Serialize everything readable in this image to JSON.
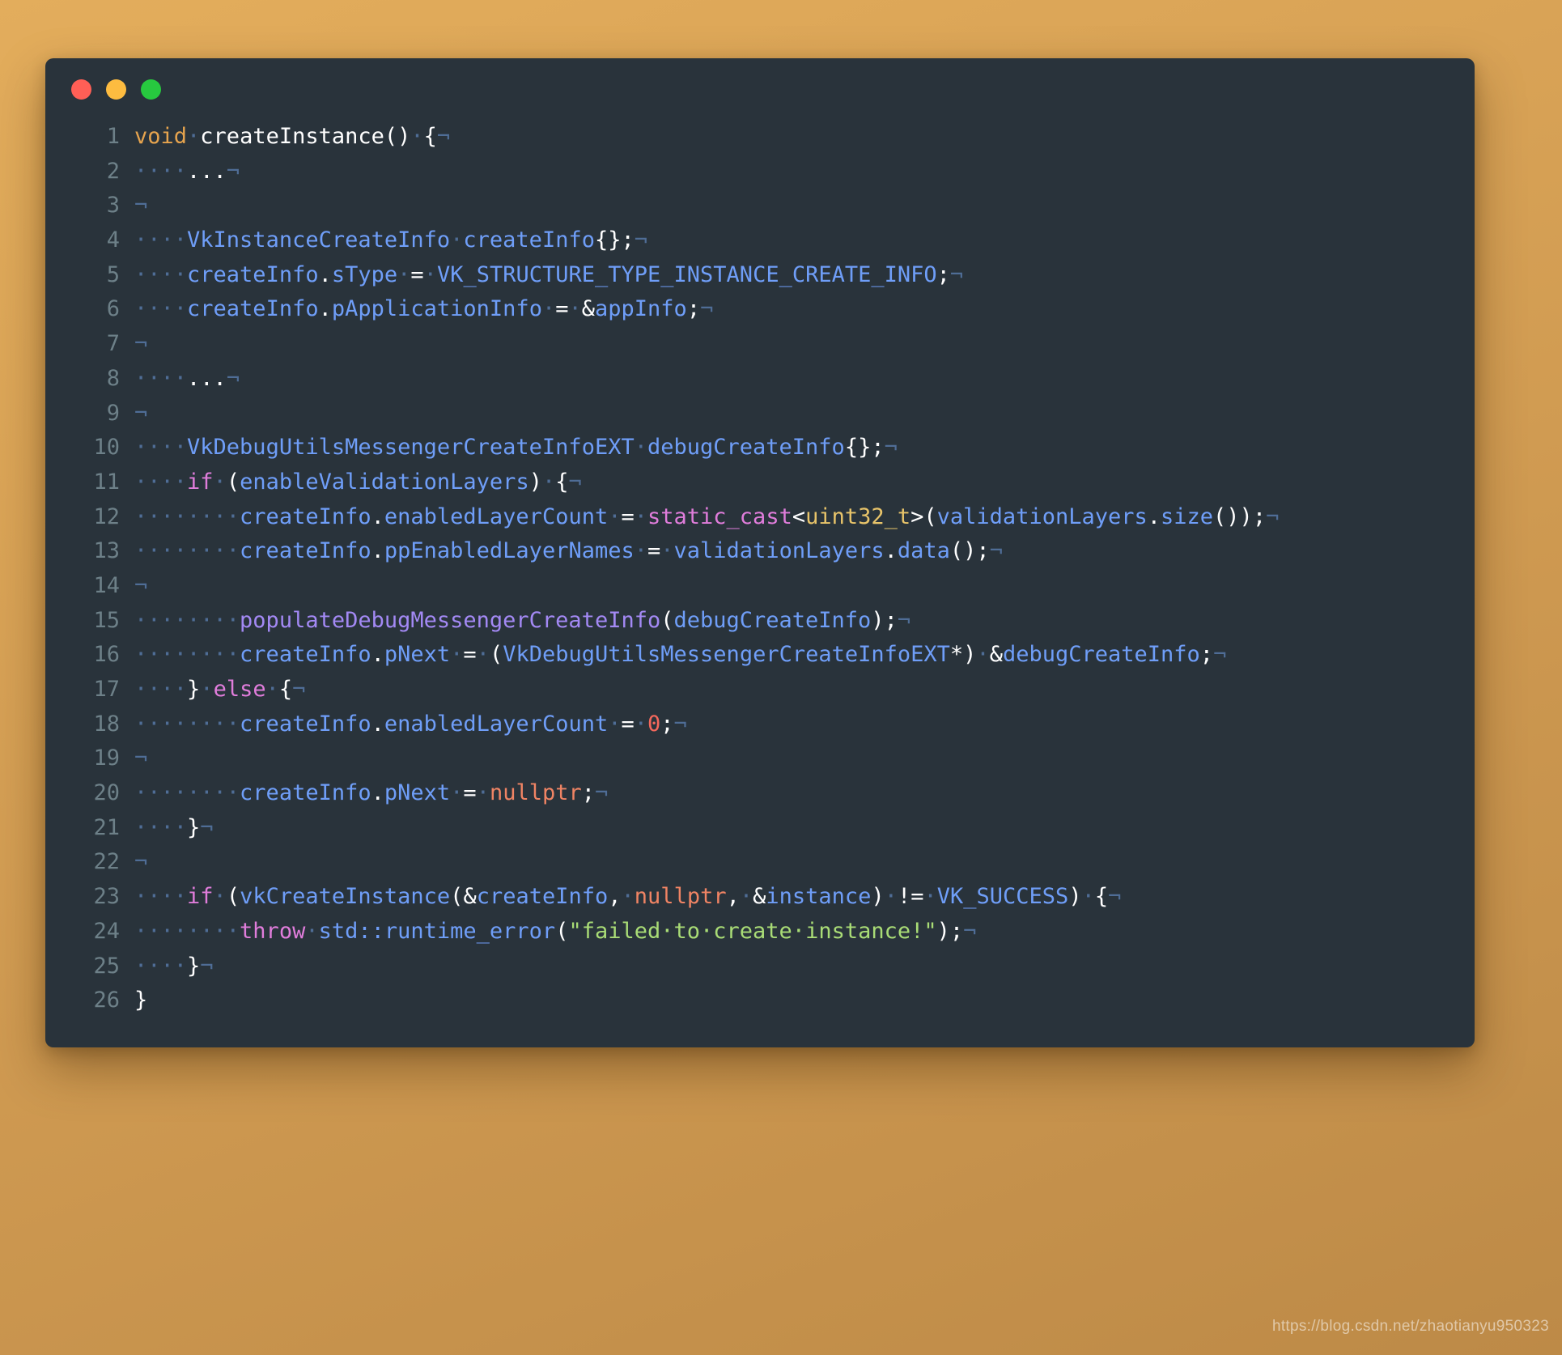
{
  "window": {
    "traffic_lights": [
      {
        "name": "close",
        "color": "#ff5f56"
      },
      {
        "name": "minimize",
        "color": "#fdbc40"
      },
      {
        "name": "maximize",
        "color": "#27c93f"
      }
    ],
    "background_color": "#29333b"
  },
  "watermark": "https://blog.csdn.net/zhaotianyu950323",
  "editor": {
    "language": "cpp",
    "show_line_numbers": true,
    "show_whitespace": true,
    "indent_dot": "·",
    "eol_marker": "¬",
    "first_line": 1,
    "last_line": 26,
    "lines": [
      {
        "n": "1",
        "tokens": [
          {
            "t": "void",
            "c": "kw"
          },
          {
            "t": "·",
            "c": "dot-i"
          },
          {
            "t": "createInstance()",
            "c": "plain"
          },
          {
            "t": "·",
            "c": "dot-i"
          },
          {
            "t": "{",
            "c": "plain"
          },
          {
            "t": "¬",
            "c": "pilcrow"
          }
        ]
      },
      {
        "n": "2",
        "tokens": [
          {
            "t": "····",
            "c": "dot-i"
          },
          {
            "t": "...",
            "c": "plain"
          },
          {
            "t": "¬",
            "c": "pilcrow"
          }
        ]
      },
      {
        "n": "3",
        "tokens": [
          {
            "t": "¬",
            "c": "pilcrow"
          }
        ]
      },
      {
        "n": "4",
        "tokens": [
          {
            "t": "····",
            "c": "dot-i"
          },
          {
            "t": "VkInstanceCreateInfo",
            "c": "type"
          },
          {
            "t": "·",
            "c": "dot-i"
          },
          {
            "t": "createInfo",
            "c": "var"
          },
          {
            "t": "{};",
            "c": "plain"
          },
          {
            "t": "¬",
            "c": "pilcrow"
          }
        ]
      },
      {
        "n": "5",
        "tokens": [
          {
            "t": "····",
            "c": "dot-i"
          },
          {
            "t": "createInfo",
            "c": "var"
          },
          {
            "t": ".",
            "c": "plain"
          },
          {
            "t": "sType",
            "c": "var"
          },
          {
            "t": "·",
            "c": "dot-i"
          },
          {
            "t": "=",
            "c": "plain"
          },
          {
            "t": "·",
            "c": "dot-i"
          },
          {
            "t": "VK_STRUCTURE_TYPE_INSTANCE_CREATE_INFO",
            "c": "macro"
          },
          {
            "t": ";",
            "c": "plain"
          },
          {
            "t": "¬",
            "c": "pilcrow"
          }
        ]
      },
      {
        "n": "6",
        "tokens": [
          {
            "t": "····",
            "c": "dot-i"
          },
          {
            "t": "createInfo",
            "c": "var"
          },
          {
            "t": ".",
            "c": "plain"
          },
          {
            "t": "pApplicationInfo",
            "c": "var"
          },
          {
            "t": "·",
            "c": "dot-i"
          },
          {
            "t": "=",
            "c": "plain"
          },
          {
            "t": "·",
            "c": "dot-i"
          },
          {
            "t": "&",
            "c": "plain"
          },
          {
            "t": "appInfo",
            "c": "var"
          },
          {
            "t": ";",
            "c": "plain"
          },
          {
            "t": "¬",
            "c": "pilcrow"
          }
        ]
      },
      {
        "n": "7",
        "tokens": [
          {
            "t": "¬",
            "c": "pilcrow"
          }
        ]
      },
      {
        "n": "8",
        "tokens": [
          {
            "t": "····",
            "c": "dot-i"
          },
          {
            "t": "...",
            "c": "plain"
          },
          {
            "t": "¬",
            "c": "pilcrow"
          }
        ]
      },
      {
        "n": "9",
        "tokens": [
          {
            "t": "¬",
            "c": "pilcrow"
          }
        ]
      },
      {
        "n": "10",
        "tokens": [
          {
            "t": "····",
            "c": "dot-i"
          },
          {
            "t": "VkDebugUtilsMessengerCreateInfoEXT",
            "c": "type"
          },
          {
            "t": "·",
            "c": "dot-i"
          },
          {
            "t": "debugCreateInfo",
            "c": "var"
          },
          {
            "t": "{};",
            "c": "plain"
          },
          {
            "t": "¬",
            "c": "pilcrow"
          }
        ]
      },
      {
        "n": "11",
        "tokens": [
          {
            "t": "····",
            "c": "dot-i"
          },
          {
            "t": "if",
            "c": "ctrl"
          },
          {
            "t": "·",
            "c": "dot-i"
          },
          {
            "t": "(",
            "c": "plain"
          },
          {
            "t": "enableValidationLayers",
            "c": "var"
          },
          {
            "t": ")",
            "c": "plain"
          },
          {
            "t": "·",
            "c": "dot-i"
          },
          {
            "t": "{",
            "c": "plain"
          },
          {
            "t": "¬",
            "c": "pilcrow"
          }
        ]
      },
      {
        "n": "12",
        "tokens": [
          {
            "t": "········",
            "c": "dot-i"
          },
          {
            "t": "createInfo",
            "c": "var"
          },
          {
            "t": ".",
            "c": "plain"
          },
          {
            "t": "enabledLayerCount",
            "c": "var"
          },
          {
            "t": "·",
            "c": "dot-i"
          },
          {
            "t": "=",
            "c": "plain"
          },
          {
            "t": "·",
            "c": "dot-i"
          },
          {
            "t": "static_cast",
            "c": "cast"
          },
          {
            "t": "<",
            "c": "plain"
          },
          {
            "t": "uint32_t",
            "c": "prim"
          },
          {
            "t": ">(",
            "c": "plain"
          },
          {
            "t": "validationLayers",
            "c": "var"
          },
          {
            "t": ".",
            "c": "plain"
          },
          {
            "t": "size",
            "c": "var"
          },
          {
            "t": "());",
            "c": "plain"
          },
          {
            "t": "¬",
            "c": "pilcrow"
          }
        ]
      },
      {
        "n": "13",
        "tokens": [
          {
            "t": "········",
            "c": "dot-i"
          },
          {
            "t": "createInfo",
            "c": "var"
          },
          {
            "t": ".",
            "c": "plain"
          },
          {
            "t": "ppEnabledLayerNames",
            "c": "var"
          },
          {
            "t": "·",
            "c": "dot-i"
          },
          {
            "t": "=",
            "c": "plain"
          },
          {
            "t": "·",
            "c": "dot-i"
          },
          {
            "t": "validationLayers",
            "c": "var"
          },
          {
            "t": ".",
            "c": "plain"
          },
          {
            "t": "data",
            "c": "var"
          },
          {
            "t": "();",
            "c": "plain"
          },
          {
            "t": "¬",
            "c": "pilcrow"
          }
        ]
      },
      {
        "n": "14",
        "tokens": [
          {
            "t": "¬",
            "c": "pilcrow"
          }
        ]
      },
      {
        "n": "15",
        "tokens": [
          {
            "t": "········",
            "c": "dot-i"
          },
          {
            "t": "populateDebugMessengerCreateInfo",
            "c": "fn"
          },
          {
            "t": "(",
            "c": "plain"
          },
          {
            "t": "debugCreateInfo",
            "c": "var"
          },
          {
            "t": ");",
            "c": "plain"
          },
          {
            "t": "¬",
            "c": "pilcrow"
          }
        ]
      },
      {
        "n": "16",
        "tokens": [
          {
            "t": "········",
            "c": "dot-i"
          },
          {
            "t": "createInfo",
            "c": "var"
          },
          {
            "t": ".",
            "c": "plain"
          },
          {
            "t": "pNext",
            "c": "var"
          },
          {
            "t": "·",
            "c": "dot-i"
          },
          {
            "t": "=",
            "c": "plain"
          },
          {
            "t": "·",
            "c": "dot-i"
          },
          {
            "t": "(",
            "c": "plain"
          },
          {
            "t": "VkDebugUtilsMessengerCreateInfoEXT",
            "c": "type"
          },
          {
            "t": "*)",
            "c": "plain"
          },
          {
            "t": "·",
            "c": "dot-i"
          },
          {
            "t": "&",
            "c": "plain"
          },
          {
            "t": "debugCreateInfo",
            "c": "var"
          },
          {
            "t": ";",
            "c": "plain"
          },
          {
            "t": "¬",
            "c": "pilcrow"
          }
        ]
      },
      {
        "n": "17",
        "tokens": [
          {
            "t": "····",
            "c": "dot-i"
          },
          {
            "t": "}",
            "c": "plain"
          },
          {
            "t": "·",
            "c": "dot-i"
          },
          {
            "t": "else",
            "c": "ctrl"
          },
          {
            "t": "·",
            "c": "dot-i"
          },
          {
            "t": "{",
            "c": "plain"
          },
          {
            "t": "¬",
            "c": "pilcrow"
          }
        ]
      },
      {
        "n": "18",
        "tokens": [
          {
            "t": "········",
            "c": "dot-i"
          },
          {
            "t": "createInfo",
            "c": "var"
          },
          {
            "t": ".",
            "c": "plain"
          },
          {
            "t": "enabledLayerCount",
            "c": "var"
          },
          {
            "t": "·",
            "c": "dot-i"
          },
          {
            "t": "=",
            "c": "plain"
          },
          {
            "t": "·",
            "c": "dot-i"
          },
          {
            "t": "0",
            "c": "num"
          },
          {
            "t": ";",
            "c": "plain"
          },
          {
            "t": "¬",
            "c": "pilcrow"
          }
        ]
      },
      {
        "n": "19",
        "tokens": [
          {
            "t": "¬",
            "c": "pilcrow"
          }
        ]
      },
      {
        "n": "20",
        "tokens": [
          {
            "t": "········",
            "c": "dot-i"
          },
          {
            "t": "createInfo",
            "c": "var"
          },
          {
            "t": ".",
            "c": "plain"
          },
          {
            "t": "pNext",
            "c": "var"
          },
          {
            "t": "·",
            "c": "dot-i"
          },
          {
            "t": "=",
            "c": "plain"
          },
          {
            "t": "·",
            "c": "dot-i"
          },
          {
            "t": "nullptr",
            "c": "const"
          },
          {
            "t": ";",
            "c": "plain"
          },
          {
            "t": "¬",
            "c": "pilcrow"
          }
        ]
      },
      {
        "n": "21",
        "tokens": [
          {
            "t": "····",
            "c": "dot-i"
          },
          {
            "t": "}",
            "c": "plain"
          },
          {
            "t": "¬",
            "c": "pilcrow"
          }
        ]
      },
      {
        "n": "22",
        "tokens": [
          {
            "t": "¬",
            "c": "pilcrow"
          }
        ]
      },
      {
        "n": "23",
        "tokens": [
          {
            "t": "····",
            "c": "dot-i"
          },
          {
            "t": "if",
            "c": "ctrl"
          },
          {
            "t": "·",
            "c": "dot-i"
          },
          {
            "t": "(",
            "c": "plain"
          },
          {
            "t": "vkCreateInstance",
            "c": "var"
          },
          {
            "t": "(",
            "c": "plain"
          },
          {
            "t": "&",
            "c": "plain"
          },
          {
            "t": "createInfo",
            "c": "var"
          },
          {
            "t": ",",
            "c": "plain"
          },
          {
            "t": "·",
            "c": "dot-i"
          },
          {
            "t": "nullptr",
            "c": "const"
          },
          {
            "t": ",",
            "c": "plain"
          },
          {
            "t": "·",
            "c": "dot-i"
          },
          {
            "t": "&",
            "c": "plain"
          },
          {
            "t": "instance",
            "c": "var"
          },
          {
            "t": ")",
            "c": "plain"
          },
          {
            "t": "·",
            "c": "dot-i"
          },
          {
            "t": "!=",
            "c": "plain"
          },
          {
            "t": "·",
            "c": "dot-i"
          },
          {
            "t": "VK_SUCCESS",
            "c": "macro"
          },
          {
            "t": ")",
            "c": "plain"
          },
          {
            "t": "·",
            "c": "dot-i"
          },
          {
            "t": "{",
            "c": "plain"
          },
          {
            "t": "¬",
            "c": "pilcrow"
          }
        ]
      },
      {
        "n": "24",
        "tokens": [
          {
            "t": "········",
            "c": "dot-i"
          },
          {
            "t": "throw",
            "c": "ctrl"
          },
          {
            "t": "·",
            "c": "dot-i"
          },
          {
            "t": "std::runtime_error",
            "c": "ident"
          },
          {
            "t": "(",
            "c": "plain"
          },
          {
            "t": "\"failed·to·create·instance!\"",
            "c": "str"
          },
          {
            "t": ");",
            "c": "plain"
          },
          {
            "t": "¬",
            "c": "pilcrow"
          }
        ]
      },
      {
        "n": "25",
        "tokens": [
          {
            "t": "····",
            "c": "dot-i"
          },
          {
            "t": "}",
            "c": "plain"
          },
          {
            "t": "¬",
            "c": "pilcrow"
          }
        ]
      },
      {
        "n": "26",
        "tokens": [
          {
            "t": "}",
            "c": "plain"
          }
        ]
      }
    ]
  }
}
